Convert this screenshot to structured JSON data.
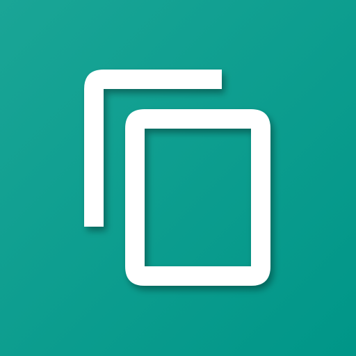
{
  "app_icon": {
    "icon": "copy-icon",
    "background_color": "#009688",
    "background_highlight_color": "#1aa596",
    "glyph_color": "#ffffff",
    "shadow_color": "#00574e"
  }
}
